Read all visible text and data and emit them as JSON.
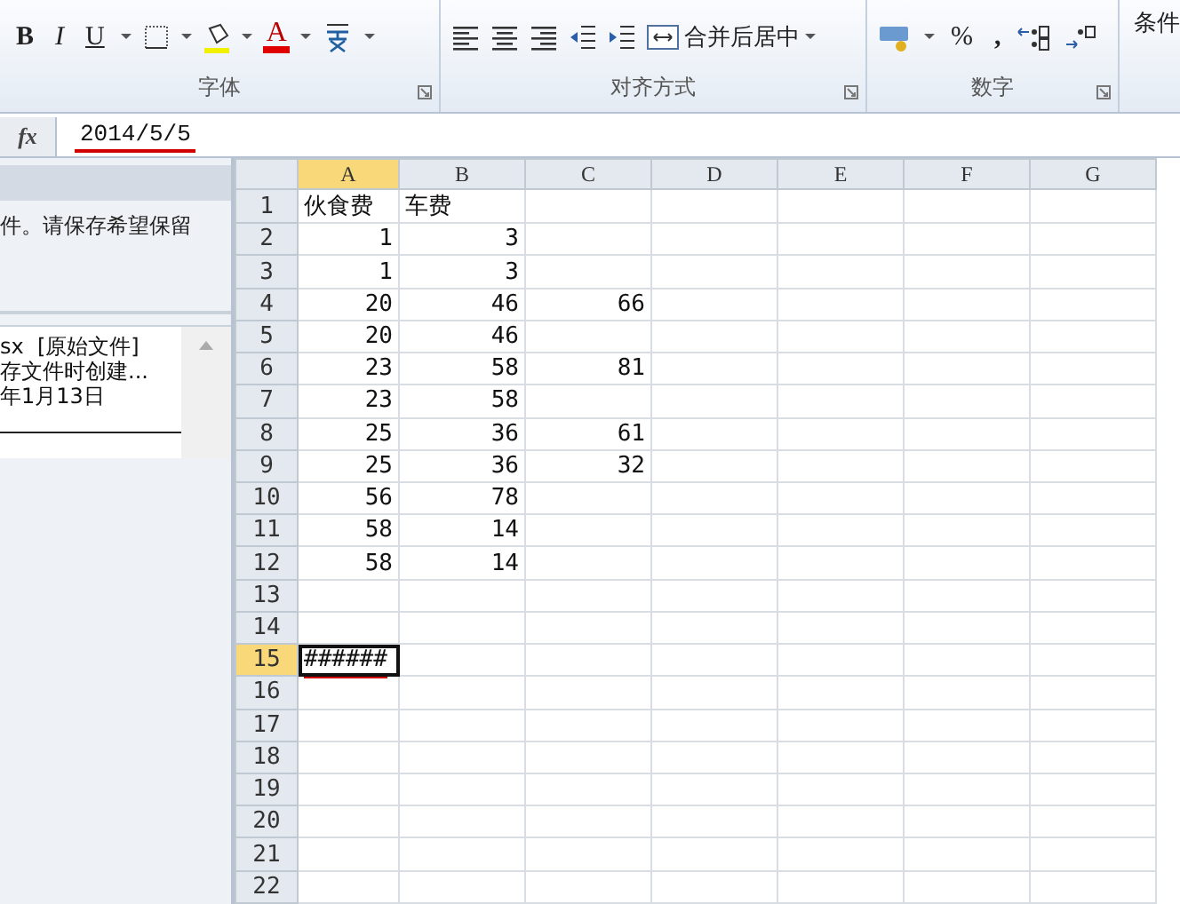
{
  "ribbon": {
    "font": {
      "bold": "B",
      "italic": "I",
      "underline": "U",
      "font_color": "A",
      "label": "字体"
    },
    "alignment": {
      "merge": "合并后居中",
      "label": "对齐方式"
    },
    "number": {
      "percent": "%",
      "comma": ",",
      "label": "数字"
    },
    "cut_off": "条件"
  },
  "formula_bar": {
    "fx": "fx",
    "value": "2014/5/5"
  },
  "recovery_pane": {
    "message": "件。请保存希望保留",
    "file_lines": [
      "sx  [原始文件]",
      "存文件时创建...",
      "年1月13日"
    ]
  },
  "sheet": {
    "columns": [
      {
        "label": "A",
        "selected": true
      },
      {
        "label": "B",
        "selected": false
      },
      {
        "label": "C",
        "selected": false
      },
      {
        "label": "D",
        "selected": false
      },
      {
        "label": "E",
        "selected": false
      },
      {
        "label": "F",
        "selected": false
      },
      {
        "label": "G",
        "selected": false
      }
    ],
    "rows": [
      {
        "header": "1",
        "selected": false,
        "cells": [
          "伙食费",
          "车费"
        ]
      },
      {
        "header": "2",
        "selected": false,
        "cells": [
          "1",
          "3"
        ]
      },
      {
        "header": "3",
        "selected": false,
        "cells": [
          "1",
          "3"
        ]
      },
      {
        "header": "4",
        "selected": false,
        "cells": [
          "20",
          "46",
          "66"
        ]
      },
      {
        "header": "5",
        "selected": false,
        "cells": [
          "20",
          "46"
        ]
      },
      {
        "header": "6",
        "selected": false,
        "cells": [
          "23",
          "58",
          "81"
        ]
      },
      {
        "header": "7",
        "selected": false,
        "cells": [
          "23",
          "58"
        ]
      },
      {
        "header": "8",
        "selected": false,
        "cells": [
          "25",
          "36",
          "61"
        ]
      },
      {
        "header": "9",
        "selected": false,
        "cells": [
          "25",
          "36",
          "32"
        ]
      },
      {
        "header": "10",
        "selected": false,
        "cells": [
          "56",
          "78"
        ]
      },
      {
        "header": "11",
        "selected": false,
        "cells": [
          "58",
          "14"
        ]
      },
      {
        "header": "12",
        "selected": false,
        "cells": [
          "58",
          "14"
        ]
      },
      {
        "header": "13",
        "selected": false,
        "cells": []
      },
      {
        "header": "14",
        "selected": false,
        "cells": []
      },
      {
        "header": "15",
        "selected": true,
        "cells": [
          "######"
        ]
      },
      {
        "header": "16",
        "selected": false,
        "cells": []
      },
      {
        "header": "17",
        "selected": false,
        "cells": []
      },
      {
        "header": "18",
        "selected": false,
        "cells": []
      },
      {
        "header": "19",
        "selected": false,
        "cells": []
      },
      {
        "header": "20",
        "selected": false,
        "cells": []
      },
      {
        "header": "21",
        "selected": false,
        "cells": []
      },
      {
        "header": "22",
        "selected": false,
        "cells": []
      }
    ]
  }
}
